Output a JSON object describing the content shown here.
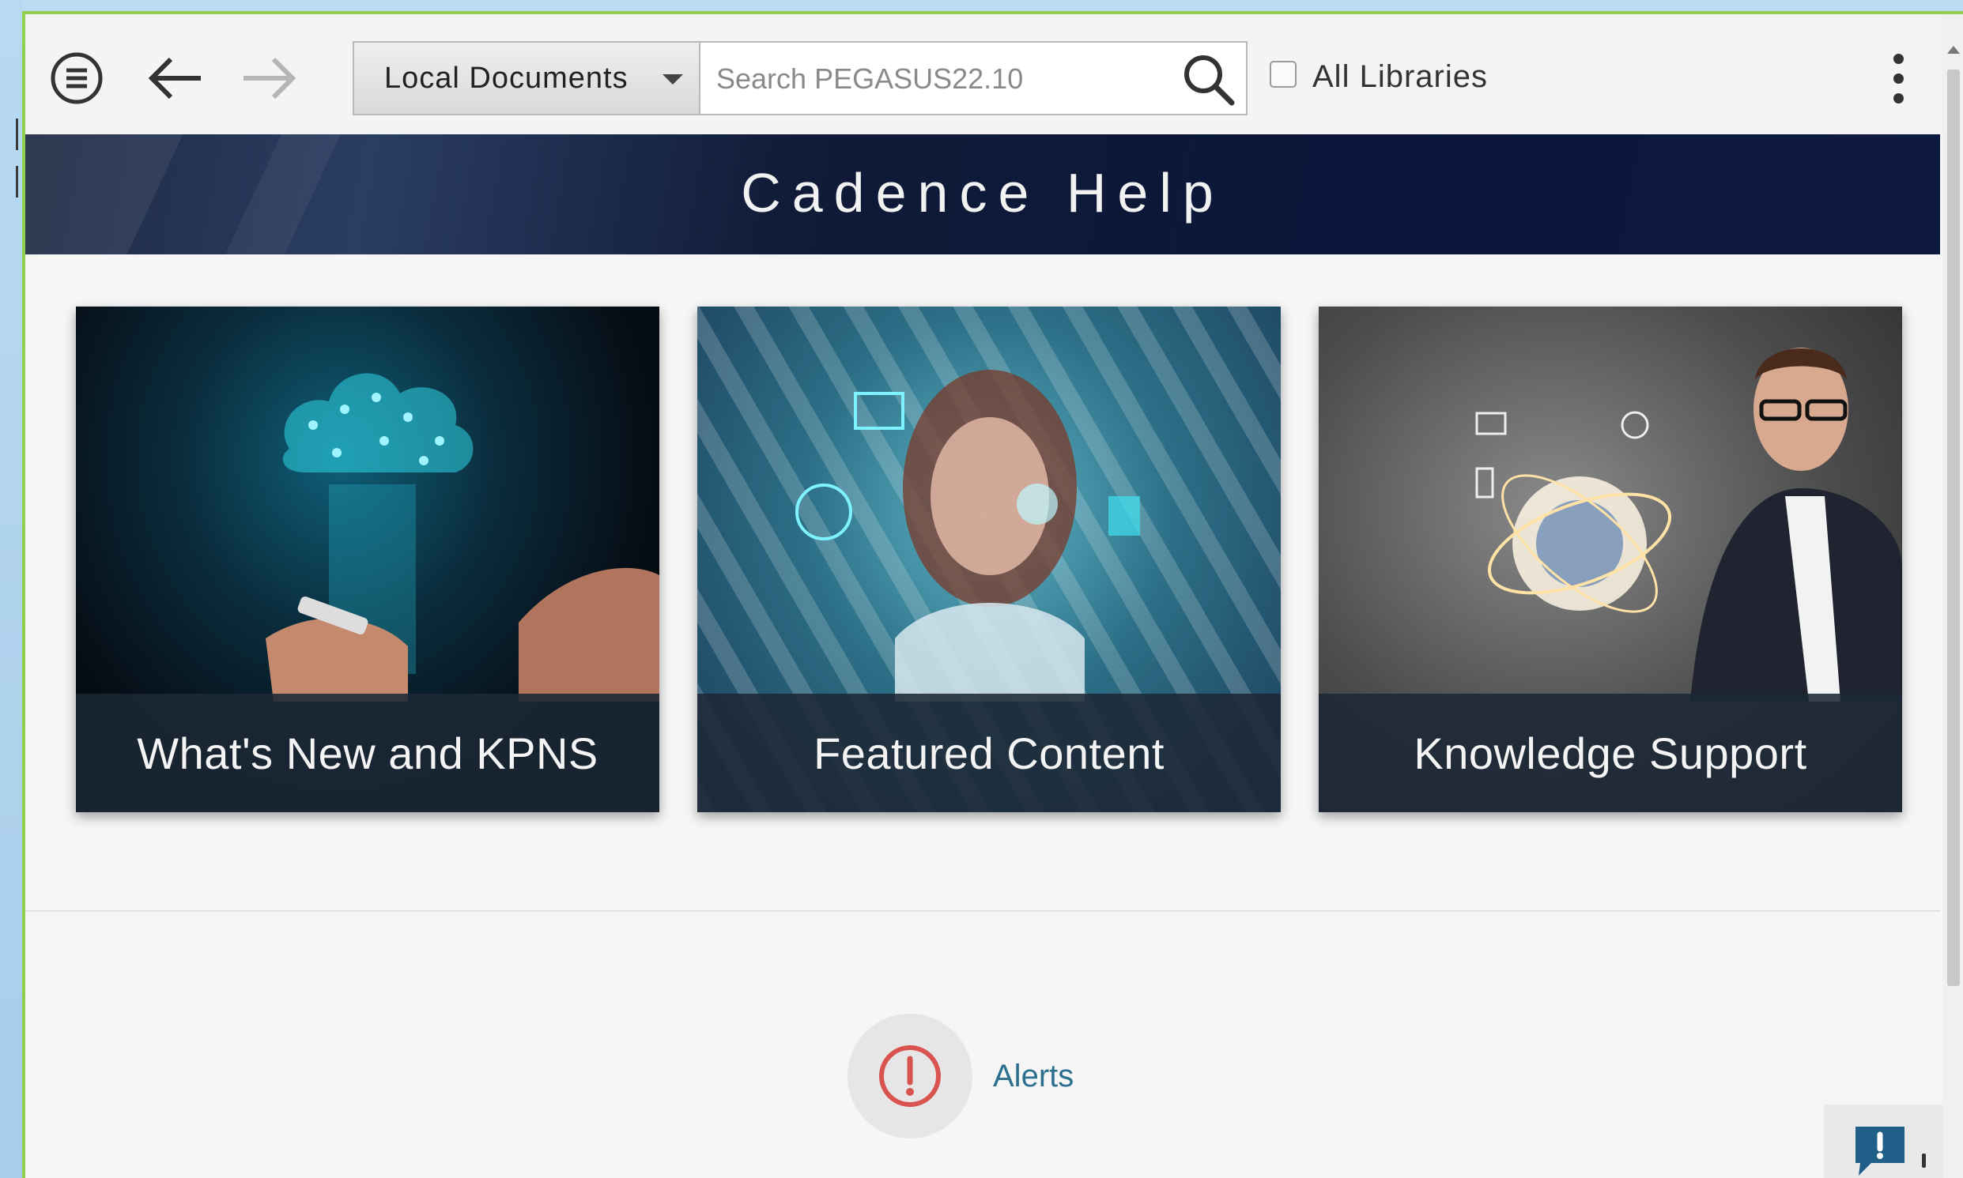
{
  "toolbar": {
    "library_selector": "Local Documents",
    "search_placeholder": "Search PEGASUS22.10",
    "all_libraries_label": "All Libraries",
    "all_libraries_checked": false
  },
  "banner": {
    "title": "Cadence Help"
  },
  "cards": [
    {
      "label": "What's New and KPNS"
    },
    {
      "label": "Featured Content"
    },
    {
      "label": "Knowledge Support"
    }
  ],
  "alerts": {
    "label": "Alerts"
  },
  "colors": {
    "accent_green": "#8fd14f",
    "banner_navy": "#0b163a",
    "alert_red": "#d9534f",
    "link_blue": "#2c6f8f",
    "feedback_blue": "#1f5f88"
  },
  "icons": {
    "menu": "menu-icon",
    "back": "back-arrow-icon",
    "forward": "forward-arrow-icon",
    "search": "search-icon",
    "more": "kebab-menu-icon",
    "alert": "alert-circle-icon",
    "feedback": "feedback-icon"
  }
}
